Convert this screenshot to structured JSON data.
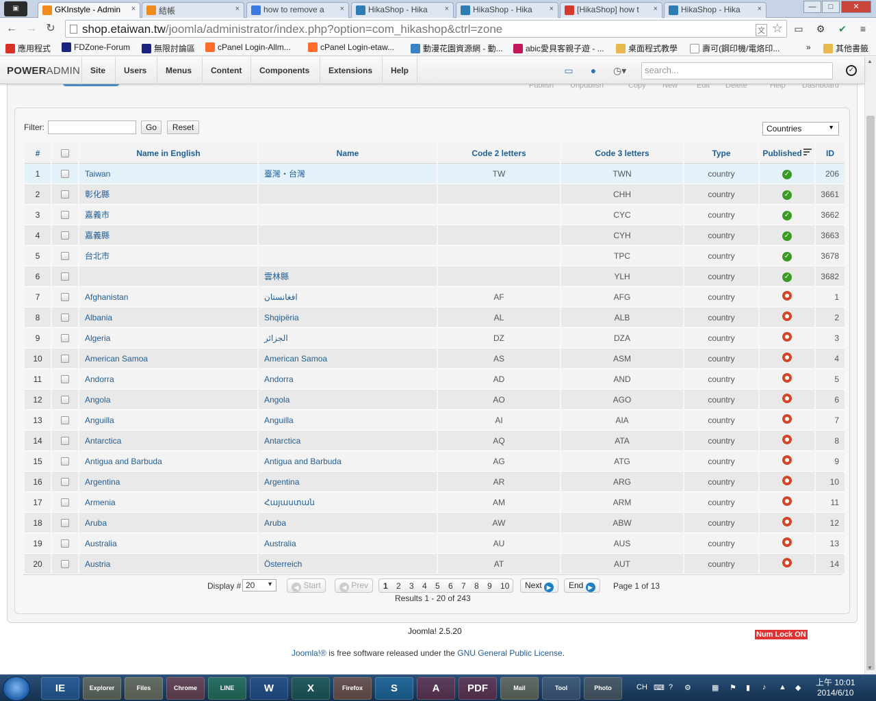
{
  "browser": {
    "tabs": [
      {
        "title": "GKInstyle - Admin",
        "close": "×",
        "favicon_color": "#f08c1e"
      },
      {
        "title": "結帳",
        "close": "×",
        "favicon_color": "#f08c1e"
      },
      {
        "title": "how to remove a",
        "close": "×",
        "favicon_color": "#3c7ae0"
      },
      {
        "title": "HikaShop - Hika",
        "close": "×",
        "favicon_color": "#2e7db5"
      },
      {
        "title": "HikaShop - Hika",
        "close": "×",
        "favicon_color": "#2e7db5"
      },
      {
        "title": "[HikaShop] how t",
        "close": "×",
        "favicon_color": "#d33a2c"
      },
      {
        "title": "HikaShop - Hika",
        "close": "×",
        "favicon_color": "#2e7db5"
      }
    ],
    "window_controls": {
      "minimize": "—",
      "maximize": "□",
      "close": "✕"
    },
    "nav": {
      "back": "←",
      "forward": "→",
      "reload": "↻"
    },
    "url_host": "shop.etaiwan.tw",
    "url_path": "/joomla/administrator/index.php?option=com_hikashop&ctrl=zone",
    "bookmarks": [
      {
        "label": "應用程式",
        "icon_color": "#d93025"
      },
      {
        "label": "FDZone-Forum",
        "icon_color": "#1a237e"
      },
      {
        "label": "無限討論區",
        "icon_color": "#1a237e"
      },
      {
        "label": "cPanel Login-Allm...",
        "icon_color": "#ff6c2c"
      },
      {
        "label": "cPanel Login-etaw...",
        "icon_color": "#ff6c2c"
      },
      {
        "label": "動漫花園資源網 - 動...",
        "icon_color": "#3b82c4"
      },
      {
        "label": "abic愛貝客親子遊 - ...",
        "icon_color": "#c2185b"
      },
      {
        "label": "桌面程式教學",
        "icon_color": "#e8b84a"
      },
      {
        "label": "壽可(鋼印機/電烙印...",
        "icon_color": "#ffffff"
      },
      {
        "label": "»",
        "icon_color": ""
      },
      {
        "label": "其他書籤",
        "icon_color": "#e8b84a"
      }
    ]
  },
  "admin": {
    "brand_bold": "POWER",
    "brand_lite": "ADMIN",
    "menu": [
      "Site",
      "Users",
      "Menus",
      "Content",
      "Components",
      "Extensions",
      "Help"
    ],
    "search_placeholder": "search..."
  },
  "subtoolbar_ghost": [
    "Publish",
    "Unpublish",
    "Copy",
    "New",
    "Edit",
    "Delete",
    "Help",
    "Dashboard"
  ],
  "filter": {
    "label": "Filter:",
    "value": "",
    "go": "Go",
    "reset": "Reset",
    "type_select": "Countries"
  },
  "table": {
    "columns": [
      "#",
      "",
      "Name in English",
      "Name",
      "Code 2 letters",
      "Code 3 letters",
      "Type",
      "Published",
      "ID"
    ],
    "rows": [
      {
        "n": "1",
        "en": "Taiwan",
        "name": "臺灣・台灣",
        "c2": "TW",
        "c3": "TWN",
        "type": "country",
        "published": true,
        "id": "206"
      },
      {
        "n": "2",
        "en": "彰化縣",
        "name": "",
        "c2": "",
        "c3": "CHH",
        "type": "country",
        "published": true,
        "id": "3661"
      },
      {
        "n": "3",
        "en": "嘉義市",
        "name": "",
        "c2": "",
        "c3": "CYC",
        "type": "country",
        "published": true,
        "id": "3662"
      },
      {
        "n": "4",
        "en": "嘉義縣",
        "name": "",
        "c2": "",
        "c3": "CYH",
        "type": "country",
        "published": true,
        "id": "3663"
      },
      {
        "n": "5",
        "en": "台北市",
        "name": "",
        "c2": "",
        "c3": "TPC",
        "type": "country",
        "published": true,
        "id": "3678"
      },
      {
        "n": "6",
        "en": "",
        "name": "雲林縣",
        "c2": "",
        "c3": "YLH",
        "type": "country",
        "published": true,
        "id": "3682"
      },
      {
        "n": "7",
        "en": "Afghanistan",
        "name": "افغانستان",
        "c2": "AF",
        "c3": "AFG",
        "type": "country",
        "published": false,
        "id": "1"
      },
      {
        "n": "8",
        "en": "Albania",
        "name": "Shqipëria",
        "c2": "AL",
        "c3": "ALB",
        "type": "country",
        "published": false,
        "id": "2"
      },
      {
        "n": "9",
        "en": "Algeria",
        "name": "الجزائر",
        "c2": "DZ",
        "c3": "DZA",
        "type": "country",
        "published": false,
        "id": "3"
      },
      {
        "n": "10",
        "en": "American Samoa",
        "name": "American Samoa",
        "c2": "AS",
        "c3": "ASM",
        "type": "country",
        "published": false,
        "id": "4"
      },
      {
        "n": "11",
        "en": "Andorra",
        "name": "Andorra",
        "c2": "AD",
        "c3": "AND",
        "type": "country",
        "published": false,
        "id": "5"
      },
      {
        "n": "12",
        "en": "Angola",
        "name": "Angola",
        "c2": "AO",
        "c3": "AGO",
        "type": "country",
        "published": false,
        "id": "6"
      },
      {
        "n": "13",
        "en": "Anguilla",
        "name": "Anguilla",
        "c2": "AI",
        "c3": "AIA",
        "type": "country",
        "published": false,
        "id": "7"
      },
      {
        "n": "14",
        "en": "Antarctica",
        "name": "Antarctica",
        "c2": "AQ",
        "c3": "ATA",
        "type": "country",
        "published": false,
        "id": "8"
      },
      {
        "n": "15",
        "en": "Antigua and Barbuda",
        "name": "Antigua and Barbuda",
        "c2": "AG",
        "c3": "ATG",
        "type": "country",
        "published": false,
        "id": "9"
      },
      {
        "n": "16",
        "en": "Argentina",
        "name": "Argentina",
        "c2": "AR",
        "c3": "ARG",
        "type": "country",
        "published": false,
        "id": "10"
      },
      {
        "n": "17",
        "en": "Armenia",
        "name": "Հայաստան",
        "c2": "AM",
        "c3": "ARM",
        "type": "country",
        "published": false,
        "id": "11"
      },
      {
        "n": "18",
        "en": "Aruba",
        "name": "Aruba",
        "c2": "AW",
        "c3": "ABW",
        "type": "country",
        "published": false,
        "id": "12"
      },
      {
        "n": "19",
        "en": "Australia",
        "name": "Australia",
        "c2": "AU",
        "c3": "AUS",
        "type": "country",
        "published": false,
        "id": "13"
      },
      {
        "n": "20",
        "en": "Austria",
        "name": "Österreich",
        "c2": "AT",
        "c3": "AUT",
        "type": "country",
        "published": false,
        "id": "14"
      }
    ]
  },
  "pagination": {
    "display_label": "Display #",
    "display_value": "20",
    "start": "Start",
    "prev": "Prev",
    "pages": [
      "1",
      "2",
      "3",
      "4",
      "5",
      "6",
      "7",
      "8",
      "9",
      "10"
    ],
    "next": "Next",
    "end": "End",
    "page_info": "Page 1 of 13",
    "results": "Results 1 - 20 of 243"
  },
  "footer": {
    "version": "Joomla! 2.5.20",
    "numlock": "Num Lock ON",
    "license_a": "Joomla!®",
    "license_mid": " is free software released under the ",
    "license_b": "GNU General Public License",
    "license_end": "."
  },
  "taskbar": {
    "apps": [
      "IE",
      "Explorer",
      "Files",
      "Chrome",
      "LINE",
      "W",
      "X",
      "Firefox",
      "S",
      "A",
      "PDF",
      "Mail",
      "Tool",
      "Photo"
    ],
    "tray": {
      "lang": "CH",
      "time": "上午 10:01",
      "date": "2014/6/10"
    }
  }
}
